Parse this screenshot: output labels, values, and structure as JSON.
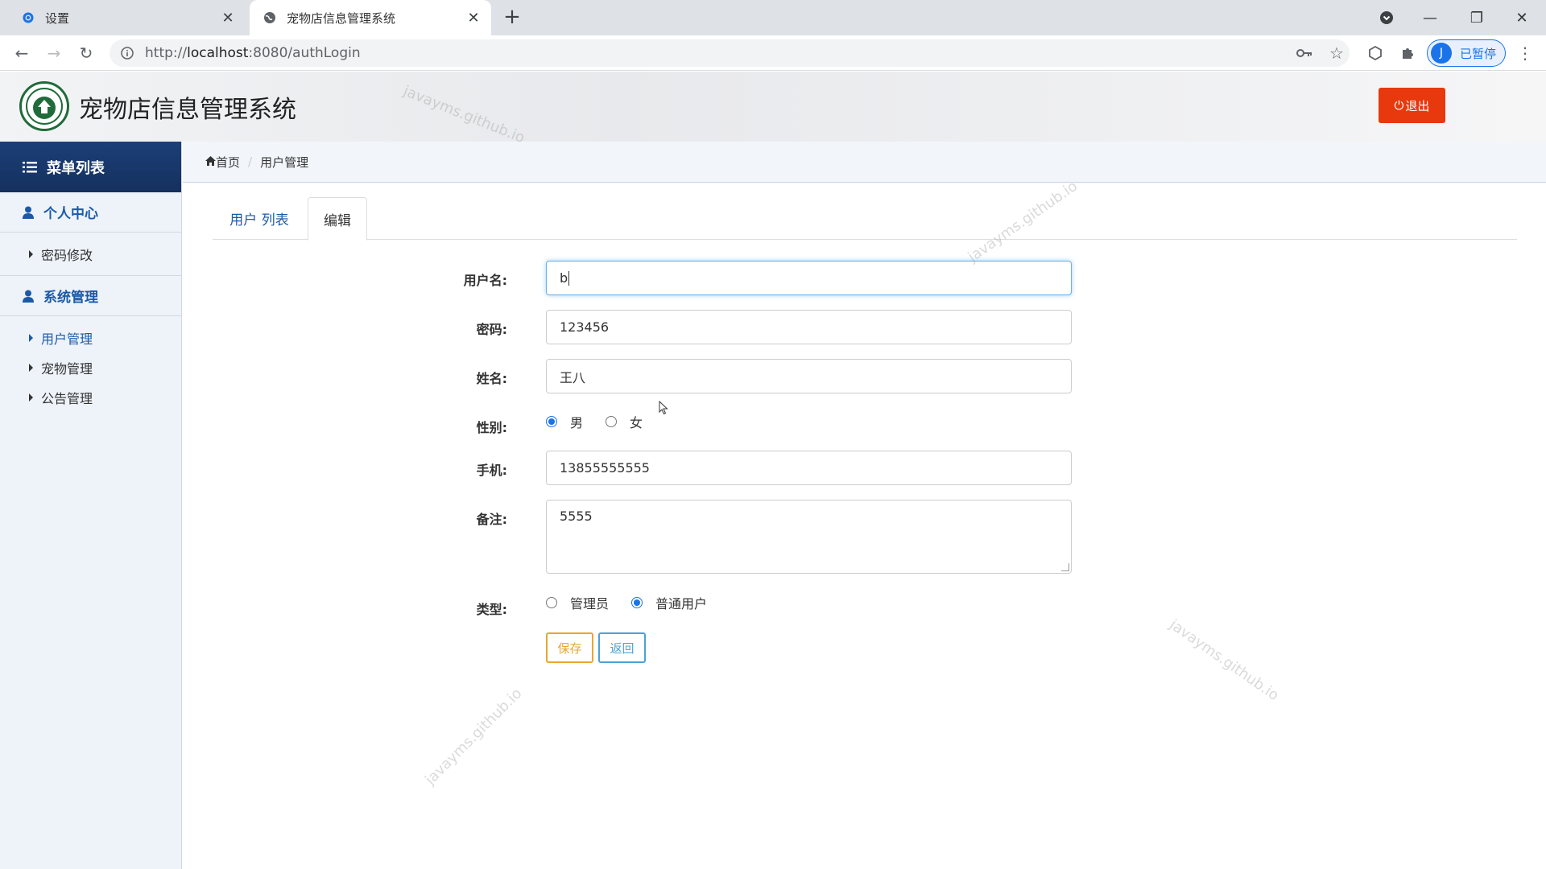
{
  "browser": {
    "tabs": [
      {
        "title": "设置",
        "active": false
      },
      {
        "title": "宠物店信息管理系统",
        "active": true
      }
    ],
    "url_prefix": "http://",
    "url_host": "localhost",
    "url_rest": ":8080/authLogin",
    "profile_initial": "J",
    "profile_label": "已暂停"
  },
  "app": {
    "title": "宠物店信息管理系统",
    "logout_label": "退出",
    "accent_color": "#e8380d"
  },
  "sidebar": {
    "header": "菜单列表",
    "groups": [
      {
        "label": "个人中心",
        "items": [
          {
            "label": "密码修改",
            "active": false
          }
        ]
      },
      {
        "label": "系统管理",
        "items": [
          {
            "label": "用户管理",
            "active": true
          },
          {
            "label": "宠物管理",
            "active": false
          },
          {
            "label": "公告管理",
            "active": false
          }
        ]
      }
    ]
  },
  "breadcrumb": {
    "home": "首页",
    "current": "用户管理"
  },
  "page_tabs": [
    {
      "label": "用户 列表",
      "active": false
    },
    {
      "label": "编辑",
      "active": true
    }
  ],
  "form": {
    "username": {
      "label": "用户名:",
      "value": "b"
    },
    "password": {
      "label": "密码:",
      "value": "123456"
    },
    "name": {
      "label": "姓名:",
      "value": "王八"
    },
    "gender": {
      "label": "性别:",
      "options": [
        "男",
        "女"
      ],
      "selected": "男"
    },
    "phone": {
      "label": "手机:",
      "value": "13855555555"
    },
    "remark": {
      "label": "备注:",
      "value": "5555"
    },
    "type": {
      "label": "类型:",
      "options": [
        "管理员",
        "普通用户"
      ],
      "selected": "普通用户"
    },
    "save_label": "保存",
    "back_label": "返回"
  },
  "watermark": "javayms.github.io"
}
